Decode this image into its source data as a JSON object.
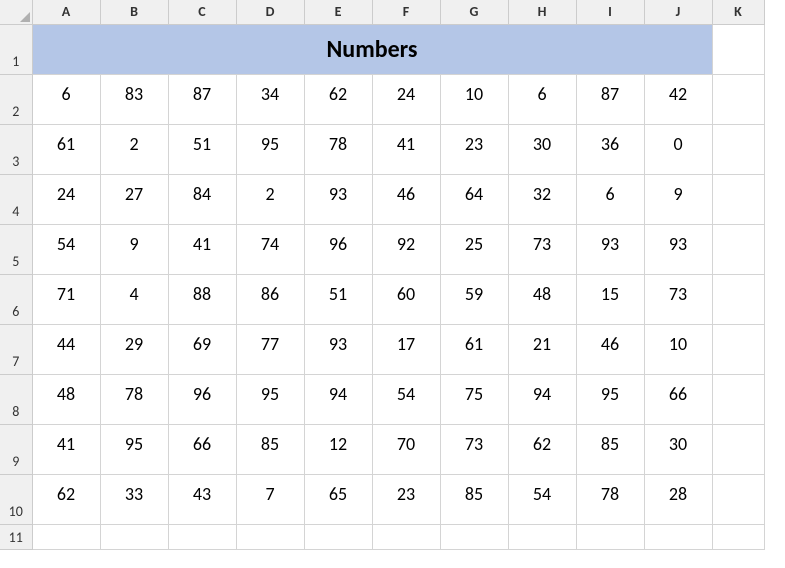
{
  "columns": [
    "A",
    "B",
    "C",
    "D",
    "E",
    "F",
    "G",
    "H",
    "I",
    "J",
    "K"
  ],
  "rowCount": 11,
  "title": "Numbers",
  "titleSpan": 10,
  "data": [
    [
      6,
      83,
      87,
      34,
      62,
      24,
      10,
      6,
      87,
      42
    ],
    [
      61,
      2,
      51,
      95,
      78,
      41,
      23,
      30,
      36,
      0
    ],
    [
      24,
      27,
      84,
      2,
      93,
      46,
      64,
      32,
      6,
      9
    ],
    [
      54,
      9,
      41,
      74,
      96,
      92,
      25,
      73,
      93,
      93
    ],
    [
      71,
      4,
      88,
      86,
      51,
      60,
      59,
      48,
      15,
      73
    ],
    [
      44,
      29,
      69,
      77,
      93,
      17,
      61,
      21,
      46,
      10
    ],
    [
      48,
      78,
      96,
      95,
      94,
      54,
      75,
      94,
      95,
      66
    ],
    [
      41,
      95,
      66,
      85,
      12,
      70,
      73,
      62,
      85,
      30
    ],
    [
      62,
      33,
      43,
      7,
      65,
      23,
      85,
      54,
      78,
      28
    ]
  ],
  "chart_data": {
    "type": "table",
    "title": "Numbers",
    "columns": [
      "A",
      "B",
      "C",
      "D",
      "E",
      "F",
      "G",
      "H",
      "I",
      "J"
    ],
    "rows": [
      [
        6,
        83,
        87,
        34,
        62,
        24,
        10,
        6,
        87,
        42
      ],
      [
        61,
        2,
        51,
        95,
        78,
        41,
        23,
        30,
        36,
        0
      ],
      [
        24,
        27,
        84,
        2,
        93,
        46,
        64,
        32,
        6,
        9
      ],
      [
        54,
        9,
        41,
        74,
        96,
        92,
        25,
        73,
        93,
        93
      ],
      [
        71,
        4,
        88,
        86,
        51,
        60,
        59,
        48,
        15,
        73
      ],
      [
        44,
        29,
        69,
        77,
        93,
        17,
        61,
        21,
        46,
        10
      ],
      [
        48,
        78,
        96,
        95,
        94,
        54,
        75,
        94,
        95,
        66
      ],
      [
        41,
        95,
        66,
        85,
        12,
        70,
        73,
        62,
        85,
        30
      ],
      [
        62,
        33,
        43,
        7,
        65,
        23,
        85,
        54,
        78,
        28
      ]
    ]
  }
}
